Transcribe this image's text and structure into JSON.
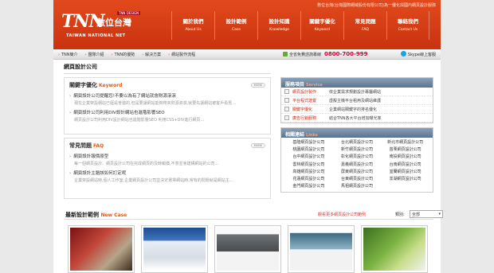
{
  "header": {
    "logo_mark": "TNN",
    "logo_cn": "數位台灣",
    "logo_en": "TAIWAN NATIONAL NET",
    "logo_since": "TNN DESIGN",
    "tagline": "數位台灣(台灣國際網域股份有限公司)為一優化與國內網頁設計服務"
  },
  "nav": [
    {
      "zh": "關於我們",
      "en": "About Us"
    },
    {
      "zh": "設計範例",
      "en": "Case"
    },
    {
      "zh": "設計知識",
      "en": "Knowledge"
    },
    {
      "zh": "關鍵字優化",
      "en": "Keyword"
    },
    {
      "zh": "常見問題",
      "en": "FAQ"
    },
    {
      "zh": "聯絡我們",
      "en": "Contact Us"
    }
  ],
  "subnav": {
    "links": [
      "TNN簡介",
      "團隊介紹",
      "TNN的優勢",
      "解決方案",
      "網站製作流程"
    ],
    "hotline_label": "全省免費諮詢專線",
    "hotline_number": "0800-700-999",
    "skype": "Skype線上客服"
  },
  "page_title": "網頁設計公司",
  "keyword_box": {
    "title": "關鍵字優化",
    "title_en": "Keyword",
    "more": "MORE",
    "items": [
      {
        "t": "網頁設計公司提醒您!不要以為有了網站就會財源滾滾",
        "d": "現在企業架設網站已經是普遍的,但是要讓網站能夠帶來財源滾滾,就要先讓網站被客戶看見..."
      },
      {
        "t": "網頁設計公司利用DIV設計網站也進階影響SEO",
        "d": "網頁設計公司利用DIV設計網站也進階影響SEO 利用CSS+DIV進行網頁..."
      }
    ]
  },
  "faq_box": {
    "title": "常見問題",
    "title_en": "FAQ",
    "more": "MORE",
    "items": [
      {
        "t": "網頁設計報價原型",
        "d": "每一個網頁設計、網頁設計公司在完成網頁的及時報價,不意並會建構網站的公司..."
      },
      {
        "t": "網頁設計主題該如何訂定呢",
        "d": "企業架設網站時,個人工作室,企業網頁設計公司並決定選擇網站時,常有的問題就是網站主..."
      }
    ]
  },
  "services": {
    "title": "服務項目",
    "title_en": "Service",
    "items": [
      {
        "name": "網頁設計製作",
        "desc": "依企業需求規劃設計專屬網站"
      },
      {
        "name": "平台程式建置",
        "desc": "虛擬主機平台租用及網站維護"
      },
      {
        "name": "關鍵字優化",
        "desc": "企業網站關鍵字的排名優化"
      },
      {
        "name": "廣告行銷服務",
        "desc": "結合TNN各大平台增加曝光率"
      }
    ]
  },
  "links_box": {
    "title": "相關連結",
    "title_en": "Links",
    "items": [
      "基隆網頁設計公司",
      "台北網頁設計公司",
      "新北市網頁設計公司",
      "桃園網頁設計公司",
      "新竹網頁設計公司",
      "苗栗網頁設計公司",
      "台中網頁設計公司",
      "彰化網頁設計公司",
      "南投網頁設計公司",
      "雲林網頁設計公司",
      "嘉義網頁設計公司",
      "台南網頁設計公司",
      "高雄網頁設計公司",
      "屏東網頁設計公司",
      "宜蘭網頁設計公司",
      "花蓮網頁設計公司",
      "台東網頁設計公司",
      "澎湖網頁設計公司",
      "金門網頁設計公司",
      "馬祖網頁設計公司",
      ""
    ]
  },
  "cases": {
    "title": "最新設計範例",
    "title_en": "New Case",
    "more_link": "觀看更多網頁設計公司範例",
    "category_label": "類別:",
    "category_value": "全部",
    "thumbs": [
      "case-1",
      "case-2",
      "case-3",
      "case-4",
      "case-5"
    ]
  }
}
